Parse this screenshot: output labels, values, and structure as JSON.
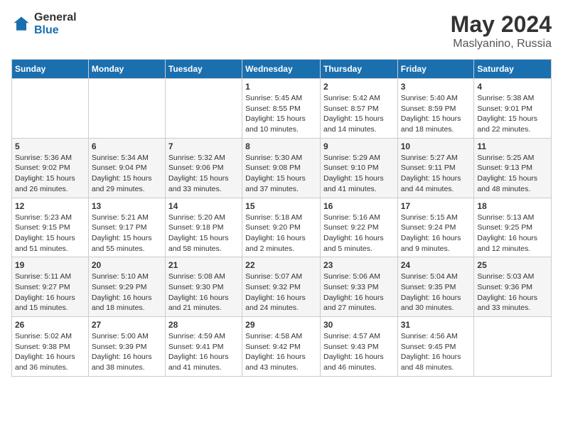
{
  "logo": {
    "general": "General",
    "blue": "Blue"
  },
  "title": {
    "month_year": "May 2024",
    "location": "Maslyanino, Russia"
  },
  "weekdays": [
    "Sunday",
    "Monday",
    "Tuesday",
    "Wednesday",
    "Thursday",
    "Friday",
    "Saturday"
  ],
  "weeks": [
    [
      {
        "day": "",
        "info": ""
      },
      {
        "day": "",
        "info": ""
      },
      {
        "day": "",
        "info": ""
      },
      {
        "day": "1",
        "info": "Sunrise: 5:45 AM\nSunset: 8:55 PM\nDaylight: 15 hours\nand 10 minutes."
      },
      {
        "day": "2",
        "info": "Sunrise: 5:42 AM\nSunset: 8:57 PM\nDaylight: 15 hours\nand 14 minutes."
      },
      {
        "day": "3",
        "info": "Sunrise: 5:40 AM\nSunset: 8:59 PM\nDaylight: 15 hours\nand 18 minutes."
      },
      {
        "day": "4",
        "info": "Sunrise: 5:38 AM\nSunset: 9:01 PM\nDaylight: 15 hours\nand 22 minutes."
      }
    ],
    [
      {
        "day": "5",
        "info": "Sunrise: 5:36 AM\nSunset: 9:02 PM\nDaylight: 15 hours\nand 26 minutes."
      },
      {
        "day": "6",
        "info": "Sunrise: 5:34 AM\nSunset: 9:04 PM\nDaylight: 15 hours\nand 29 minutes."
      },
      {
        "day": "7",
        "info": "Sunrise: 5:32 AM\nSunset: 9:06 PM\nDaylight: 15 hours\nand 33 minutes."
      },
      {
        "day": "8",
        "info": "Sunrise: 5:30 AM\nSunset: 9:08 PM\nDaylight: 15 hours\nand 37 minutes."
      },
      {
        "day": "9",
        "info": "Sunrise: 5:29 AM\nSunset: 9:10 PM\nDaylight: 15 hours\nand 41 minutes."
      },
      {
        "day": "10",
        "info": "Sunrise: 5:27 AM\nSunset: 9:11 PM\nDaylight: 15 hours\nand 44 minutes."
      },
      {
        "day": "11",
        "info": "Sunrise: 5:25 AM\nSunset: 9:13 PM\nDaylight: 15 hours\nand 48 minutes."
      }
    ],
    [
      {
        "day": "12",
        "info": "Sunrise: 5:23 AM\nSunset: 9:15 PM\nDaylight: 15 hours\nand 51 minutes."
      },
      {
        "day": "13",
        "info": "Sunrise: 5:21 AM\nSunset: 9:17 PM\nDaylight: 15 hours\nand 55 minutes."
      },
      {
        "day": "14",
        "info": "Sunrise: 5:20 AM\nSunset: 9:18 PM\nDaylight: 15 hours\nand 58 minutes."
      },
      {
        "day": "15",
        "info": "Sunrise: 5:18 AM\nSunset: 9:20 PM\nDaylight: 16 hours\nand 2 minutes."
      },
      {
        "day": "16",
        "info": "Sunrise: 5:16 AM\nSunset: 9:22 PM\nDaylight: 16 hours\nand 5 minutes."
      },
      {
        "day": "17",
        "info": "Sunrise: 5:15 AM\nSunset: 9:24 PM\nDaylight: 16 hours\nand 9 minutes."
      },
      {
        "day": "18",
        "info": "Sunrise: 5:13 AM\nSunset: 9:25 PM\nDaylight: 16 hours\nand 12 minutes."
      }
    ],
    [
      {
        "day": "19",
        "info": "Sunrise: 5:11 AM\nSunset: 9:27 PM\nDaylight: 16 hours\nand 15 minutes."
      },
      {
        "day": "20",
        "info": "Sunrise: 5:10 AM\nSunset: 9:29 PM\nDaylight: 16 hours\nand 18 minutes."
      },
      {
        "day": "21",
        "info": "Sunrise: 5:08 AM\nSunset: 9:30 PM\nDaylight: 16 hours\nand 21 minutes."
      },
      {
        "day": "22",
        "info": "Sunrise: 5:07 AM\nSunset: 9:32 PM\nDaylight: 16 hours\nand 24 minutes."
      },
      {
        "day": "23",
        "info": "Sunrise: 5:06 AM\nSunset: 9:33 PM\nDaylight: 16 hours\nand 27 minutes."
      },
      {
        "day": "24",
        "info": "Sunrise: 5:04 AM\nSunset: 9:35 PM\nDaylight: 16 hours\nand 30 minutes."
      },
      {
        "day": "25",
        "info": "Sunrise: 5:03 AM\nSunset: 9:36 PM\nDaylight: 16 hours\nand 33 minutes."
      }
    ],
    [
      {
        "day": "26",
        "info": "Sunrise: 5:02 AM\nSunset: 9:38 PM\nDaylight: 16 hours\nand 36 minutes."
      },
      {
        "day": "27",
        "info": "Sunrise: 5:00 AM\nSunset: 9:39 PM\nDaylight: 16 hours\nand 38 minutes."
      },
      {
        "day": "28",
        "info": "Sunrise: 4:59 AM\nSunset: 9:41 PM\nDaylight: 16 hours\nand 41 minutes."
      },
      {
        "day": "29",
        "info": "Sunrise: 4:58 AM\nSunset: 9:42 PM\nDaylight: 16 hours\nand 43 minutes."
      },
      {
        "day": "30",
        "info": "Sunrise: 4:57 AM\nSunset: 9:43 PM\nDaylight: 16 hours\nand 46 minutes."
      },
      {
        "day": "31",
        "info": "Sunrise: 4:56 AM\nSunset: 9:45 PM\nDaylight: 16 hours\nand 48 minutes."
      },
      {
        "day": "",
        "info": ""
      }
    ]
  ]
}
